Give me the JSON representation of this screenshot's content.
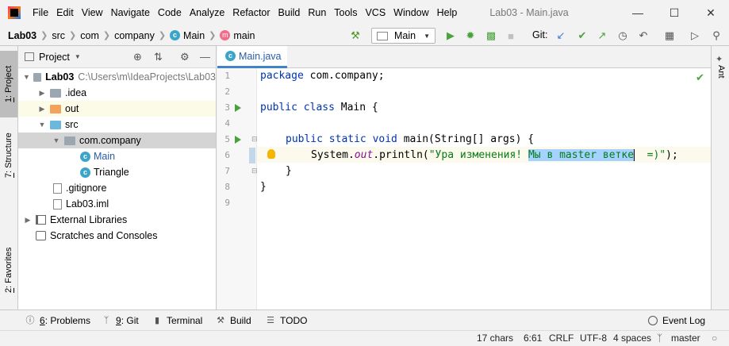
{
  "window": {
    "title": "Lab03 - Main.java",
    "menu": [
      "File",
      "Edit",
      "View",
      "Navigate",
      "Code",
      "Analyze",
      "Refactor",
      "Build",
      "Run",
      "Tools",
      "VCS",
      "Window",
      "Help"
    ]
  },
  "navbar": {
    "breadcrumbs": [
      "Lab03",
      "src",
      "com",
      "company",
      "Main",
      "main"
    ],
    "run_config": "Main",
    "git_label": "Git:"
  },
  "left_stripe": {
    "tabs": [
      {
        "num": "1",
        "label": ": Project"
      },
      {
        "num": "7",
        "label": ": Structure"
      },
      {
        "num": "2",
        "label": ": Favorites"
      }
    ]
  },
  "project": {
    "title": "Project",
    "tree": [
      {
        "label": "Lab03",
        "path": "C:\\Users\\m\\IdeaProjects\\Lab03"
      },
      {
        "label": ".idea"
      },
      {
        "label": "out"
      },
      {
        "label": "src"
      },
      {
        "label": "com.company"
      },
      {
        "label": "Main"
      },
      {
        "label": "Triangle"
      },
      {
        "label": ".gitignore"
      },
      {
        "label": "Lab03.iml"
      },
      {
        "label": "External Libraries"
      },
      {
        "label": "Scratches and Consoles"
      }
    ]
  },
  "editor": {
    "tab": "Main.java",
    "line_numbers": [
      "1",
      "2",
      "3",
      "4",
      "5",
      "6",
      "7",
      "8",
      "9"
    ],
    "code": {
      "l1_kw": "package",
      "l1_rest": " com.company;",
      "l3_kw": "public class",
      "l3_rest": " Main {",
      "l5_kw": "public static void",
      "l5_rest": " main(String[] args) {",
      "l6_a": "System.",
      "l6_field": "out",
      "l6_b": ".println(",
      "l6_str_a": "\"Ура изменения! ",
      "l6_str_sel": "Мы в master ветке",
      "l6_str_b": "  =)\"",
      "l6_end": ");",
      "l7": "}",
      "l8": "}"
    }
  },
  "right_stripe": {
    "label": "Ant"
  },
  "bottom_tools": [
    {
      "num": "6",
      "label": ": Problems"
    },
    {
      "num": "9",
      "label": ": Git"
    },
    {
      "label": "Terminal"
    },
    {
      "label": "Build"
    },
    {
      "label": "TODO"
    }
  ],
  "event_log": "Event Log",
  "status": {
    "chars": "17 chars",
    "position": "6:61",
    "line_sep": "CRLF",
    "encoding": "UTF-8",
    "indent": "4 spaces",
    "branch": "master"
  }
}
